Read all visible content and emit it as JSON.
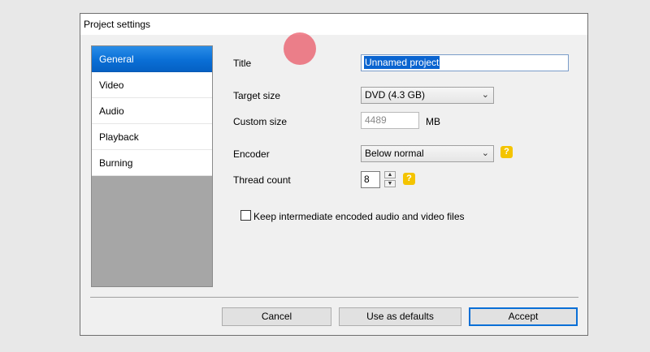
{
  "window": {
    "title": "Project settings"
  },
  "sidebar": {
    "items": [
      {
        "label": "General",
        "active": true
      },
      {
        "label": "Video"
      },
      {
        "label": "Audio"
      },
      {
        "label": "Playback"
      },
      {
        "label": "Burning"
      }
    ]
  },
  "form": {
    "title_label": "Title",
    "title_value": "Unnamed project",
    "target_size_label": "Target size",
    "target_size_value": "DVD (4.3 GB)",
    "custom_size_label": "Custom size",
    "custom_size_value": "4489",
    "custom_size_unit": "MB",
    "encoder_label": "Encoder",
    "encoder_value": "Below normal",
    "thread_count_label": "Thread count",
    "thread_count_value": "8",
    "help_glyph": "?",
    "keep_files_label": "Keep intermediate encoded audio and video files",
    "keep_files_checked": false
  },
  "buttons": {
    "cancel": "Cancel",
    "defaults": "Use as defaults",
    "accept": "Accept"
  },
  "colors": {
    "accent": "#0a6fd6",
    "help_badge": "#f4c400"
  }
}
